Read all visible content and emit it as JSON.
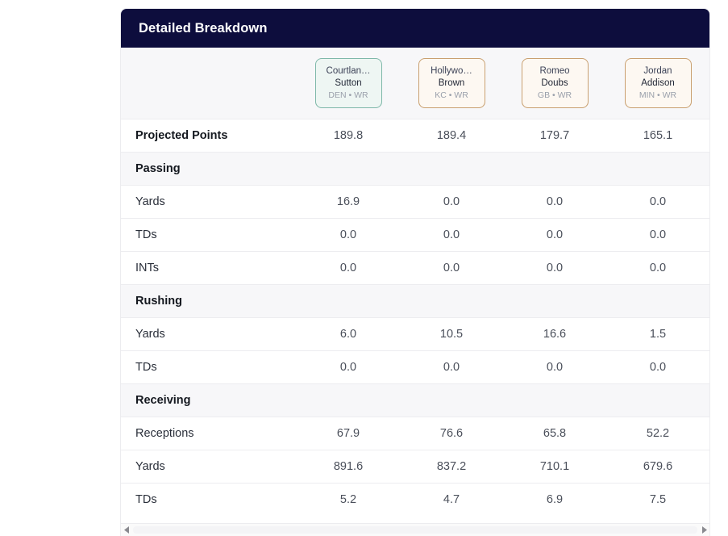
{
  "header": {
    "title": "Detailed Breakdown"
  },
  "players": [
    {
      "first_name": "Courtlan…",
      "last_name": "Sutton",
      "meta": "DEN • WR",
      "accent": "#7fb8a9",
      "fill": "#eef6f3",
      "highlight": true
    },
    {
      "first_name": "Hollywo…",
      "last_name": "Brown",
      "meta": "KC • WR",
      "accent": "#c9a070",
      "fill": "#fdf8f2",
      "highlight": false
    },
    {
      "first_name": "Romeo",
      "last_name": "Doubs",
      "meta": "GB • WR",
      "accent": "#c9a070",
      "fill": "#fdf8f2",
      "highlight": false
    },
    {
      "first_name": "Jordan",
      "last_name": "Addison",
      "meta": "MIN • WR",
      "accent": "#c9a070",
      "fill": "#fdf8f2",
      "highlight": false
    }
  ],
  "rows": [
    {
      "kind": "data",
      "label": "Projected Points",
      "emphasis": true,
      "values": [
        "189.8",
        "189.4",
        "179.7",
        "165.1"
      ]
    },
    {
      "kind": "section",
      "label": "Passing"
    },
    {
      "kind": "data",
      "label": "Yards",
      "emphasis": false,
      "values": [
        "16.9",
        "0.0",
        "0.0",
        "0.0"
      ]
    },
    {
      "kind": "data",
      "label": "TDs",
      "emphasis": false,
      "values": [
        "0.0",
        "0.0",
        "0.0",
        "0.0"
      ]
    },
    {
      "kind": "data",
      "label": "INTs",
      "emphasis": false,
      "values": [
        "0.0",
        "0.0",
        "0.0",
        "0.0"
      ]
    },
    {
      "kind": "section",
      "label": "Rushing"
    },
    {
      "kind": "data",
      "label": "Yards",
      "emphasis": false,
      "values": [
        "6.0",
        "10.5",
        "16.6",
        "1.5"
      ]
    },
    {
      "kind": "data",
      "label": "TDs",
      "emphasis": false,
      "values": [
        "0.0",
        "0.0",
        "0.0",
        "0.0"
      ]
    },
    {
      "kind": "section",
      "label": "Receiving"
    },
    {
      "kind": "data",
      "label": "Receptions",
      "emphasis": false,
      "values": [
        "67.9",
        "76.6",
        "65.8",
        "52.2"
      ]
    },
    {
      "kind": "data",
      "label": "Yards",
      "emphasis": false,
      "values": [
        "891.6",
        "837.2",
        "710.1",
        "679.6"
      ]
    },
    {
      "kind": "data",
      "label": "TDs",
      "emphasis": false,
      "values": [
        "5.2",
        "4.7",
        "6.9",
        "7.5"
      ]
    }
  ],
  "scrollbar": {
    "left_arrow_icon": "triangle-left-icon",
    "right_arrow_icon": "triangle-right-icon"
  },
  "colors": {
    "header_bg": "#0d0d3d",
    "header_text": "#ffffff",
    "section_band": "#f7f7f9",
    "row_divider": "#ededf0",
    "page_bg": "#ffffff"
  }
}
